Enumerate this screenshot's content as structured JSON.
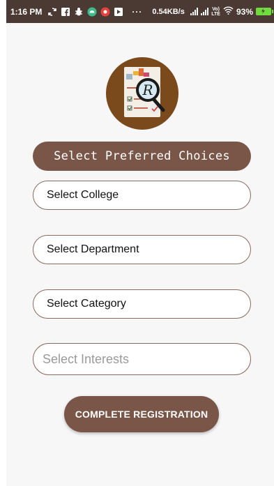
{
  "status_bar": {
    "time": "1:16 PM",
    "dots": "···",
    "network_speed": "0.54KB/s",
    "volte_top": "Vo)",
    "volte_bottom": "LTE",
    "battery": "93%",
    "battery_color": "#6ddc3c"
  },
  "logo": {
    "letter": "R"
  },
  "header": {
    "title": "Select Preferred Choices"
  },
  "fields": {
    "college": "Select College",
    "department": "Select Department",
    "category": "Select Category",
    "interests_placeholder": "Select Interests"
  },
  "button": {
    "label": "COMPLETE REGISTRATION"
  },
  "colors": {
    "status_bar_bg": "#4b3a34",
    "accent_brown": "#7a5649",
    "logo_bg": "#7b4a1c",
    "field_border": "#8a6a5f"
  }
}
